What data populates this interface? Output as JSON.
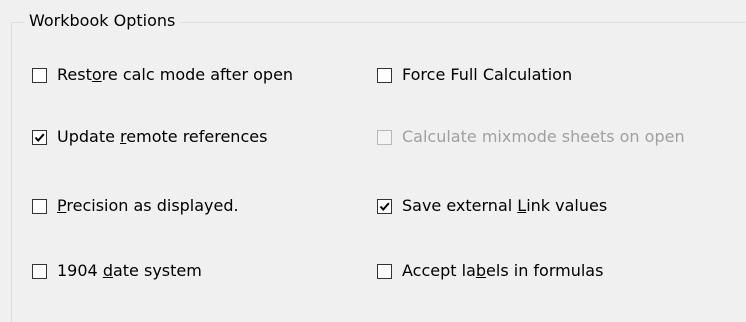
{
  "group": {
    "title": "Workbook Options"
  },
  "options": [
    {
      "pre": "Rest",
      "key": "o",
      "post": "re calc mode after open",
      "checked": false,
      "enabled": true
    },
    {
      "pre": "Force Full Calculation",
      "key": "",
      "post": "",
      "checked": false,
      "enabled": true
    },
    {
      "pre": "Update ",
      "key": "r",
      "post": "emote references",
      "checked": true,
      "enabled": true
    },
    {
      "pre": "Calculate mixmode sheets on open",
      "key": "",
      "post": "",
      "checked": false,
      "enabled": false
    },
    {
      "pre": "",
      "key": "P",
      "post": "recision as displayed.",
      "checked": false,
      "enabled": true
    },
    {
      "pre": "Save external ",
      "key": "L",
      "post": "ink values",
      "checked": true,
      "enabled": true
    },
    {
      "pre": "1904 ",
      "key": "d",
      "post": "ate system",
      "checked": false,
      "enabled": true
    },
    {
      "pre": "Accept la",
      "key": "b",
      "post": "els in formulas",
      "checked": false,
      "enabled": true
    }
  ]
}
